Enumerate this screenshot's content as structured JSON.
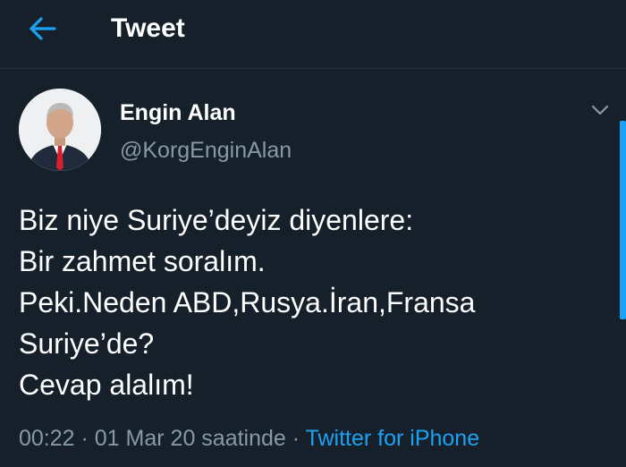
{
  "header": {
    "title": "Tweet",
    "back_icon": "arrow-left-icon"
  },
  "tweet": {
    "author": {
      "name": "Engin Alan",
      "handle": "@KorgEnginAlan"
    },
    "text_lines": [
      "Biz niye Suriye’deyiz diyenlere:",
      "Bir zahmet soralım.",
      "Peki.Neden ABD,Rusya.İran,Fransa",
      "Suriye’de?",
      "Cevap alalım!"
    ],
    "meta": {
      "time": "00:22",
      "separator": " · ",
      "date_text": "01 Mar 20 saatinde",
      "source": "Twitter for iPhone"
    },
    "menu_icon": "chevron-down-icon"
  },
  "colors": {
    "background": "#15202b",
    "accent": "#1da1f2",
    "secondary_text": "#8899a6",
    "divider": "#253341"
  }
}
